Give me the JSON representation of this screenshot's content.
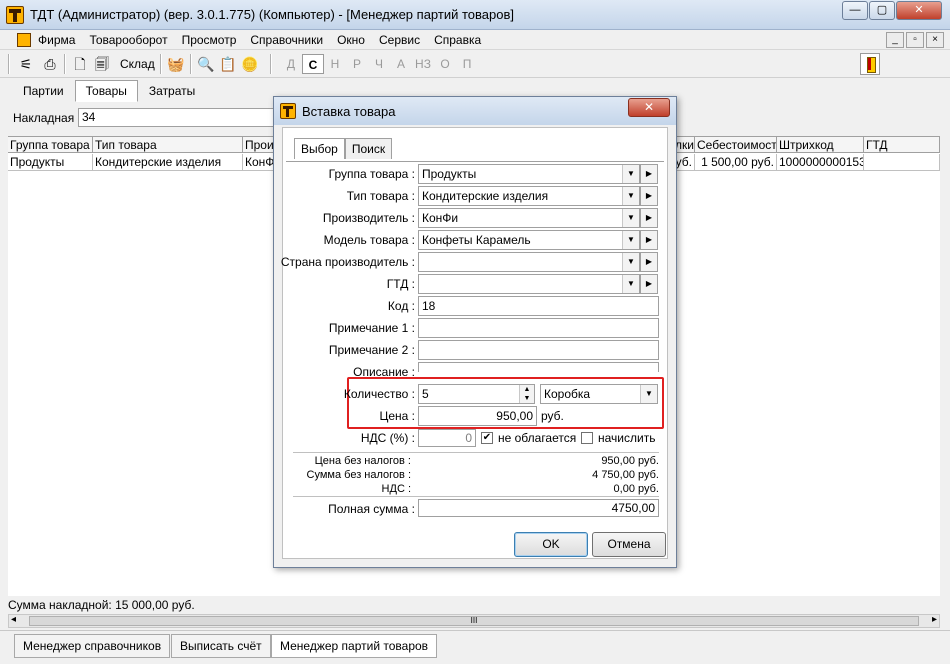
{
  "window": {
    "title": "ТДТ  (Администратор) (вер. 3.0.1.775)                              (Компьютер) - [Менеджер партий товаров]",
    "minimize": "—",
    "maximize": "▢",
    "close": "✕"
  },
  "menu": {
    "items": [
      "Фирма",
      "Товарооборот",
      "Просмотр",
      "Справочники",
      "Окно",
      "Сервис",
      "Справка"
    ],
    "mdi_controls": [
      "_",
      "▫",
      "×"
    ]
  },
  "toolbar": {
    "sklad_label": "Склад",
    "letters": [
      "Д",
      "С",
      "Н",
      "Р",
      "Ч",
      "А",
      "НЗ",
      "О",
      "П"
    ]
  },
  "main": {
    "tabs": [
      "Партии",
      "Товары",
      "Затраты"
    ],
    "active_tab": "Товары",
    "nakladnaya_label": "Накладная :",
    "nakladnaya_value": "34",
    "grid": {
      "columns": [
        "Группа товара",
        "Тип товара",
        "Прои",
        "лки",
        "Себестоимость",
        "Штрихкод",
        "ГТД"
      ],
      "row": [
        "Продукты",
        "Кондитерские изделия",
        "КонФи",
        "уб.",
        "1 500,00 руб.",
        "1000000000153",
        ""
      ]
    },
    "summa_text": "Сумма накладной: 15 000,00 руб.",
    "scroll_thumb": "III"
  },
  "taskbar": {
    "items": [
      "Менеджер справочников",
      "Выписать счёт",
      "Менеджер партий товаров"
    ]
  },
  "dialog": {
    "title": "Вставка товара",
    "close": "✕",
    "tabs": [
      "Выбор",
      "Поиск"
    ],
    "fields": {
      "gruppa_label": "Группа товара :",
      "gruppa_value": "Продукты",
      "tip_label": "Тип товара :",
      "tip_value": "Кондитерские изделия",
      "proizv_label": "Производитель :",
      "proizv_value": "КонФи",
      "model_label": "Модель товара :",
      "model_value": "Конфеты Карамель",
      "strana_label": "Страна производитель :",
      "strana_value": "",
      "gtd_label": "ГТД :",
      "gtd_value": "",
      "kod_label": "Код :",
      "kod_value": "18",
      "prim1_label": "Примечание 1 :",
      "prim1_value": "",
      "prim2_label": "Примечание 2 :",
      "prim2_value": "",
      "opisanie_label": "Описание :",
      "kolichestvo_label": "Количество :",
      "kolichestvo_value": "5",
      "unit_value": "Коробка",
      "cena_label": "Цена :",
      "cena_value": "950,00",
      "currency": "руб.",
      "nds_label": "НДС (%) :",
      "nds_value": "0",
      "ne_oblagaetsya": "не облагается",
      "nachislit": "начислить"
    },
    "summary": {
      "cena_bez_label": "Цена без налогов :",
      "cena_bez_value": "950,00 руб.",
      "summa_bez_label": "Сумма без налогов :",
      "summa_bez_value": "4 750,00 руб.",
      "nds_label": "НДС :",
      "nds_value": "0,00 руб."
    },
    "total_label": "Полная сумма :",
    "total_value": "4750,00",
    "ok": "OK",
    "cancel": "Отмена"
  },
  "colors": {
    "highlight": "#e02020",
    "title_gradient_top": "#dfe9f5",
    "title_gradient_bottom": "#c4d5ea"
  }
}
